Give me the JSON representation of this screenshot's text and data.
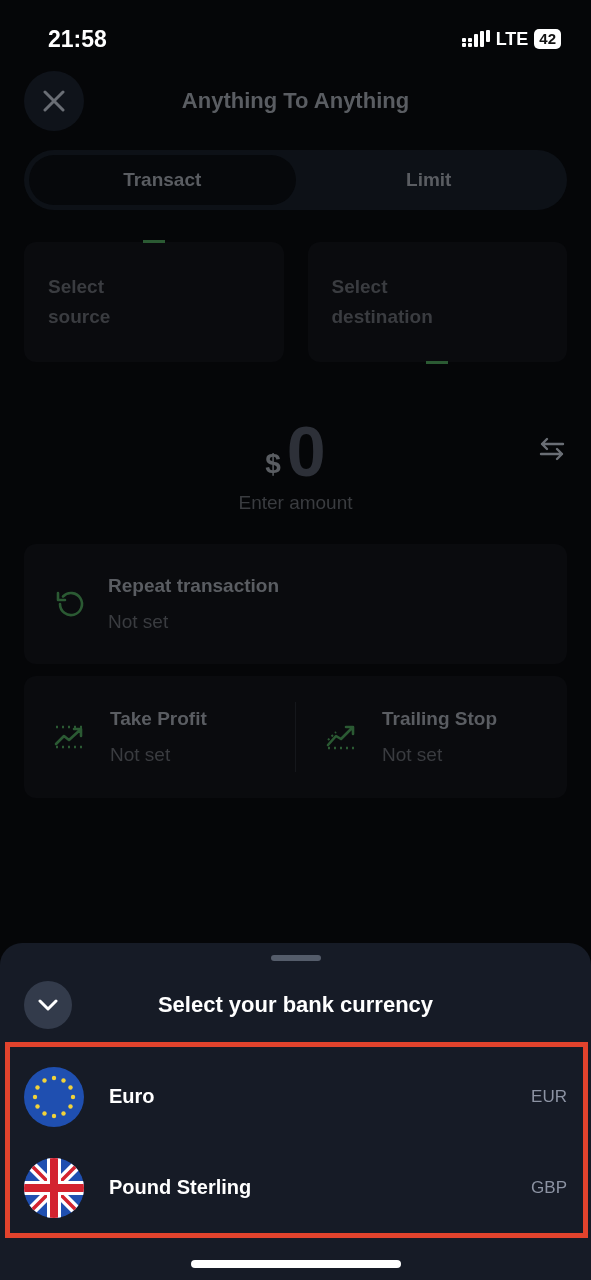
{
  "status_bar": {
    "time": "21:58",
    "network": "LTE",
    "battery": "42"
  },
  "header": {
    "title": "Anything To Anything"
  },
  "tabs": [
    {
      "label": "Transact",
      "selected": true
    },
    {
      "label": "Limit",
      "selected": false
    }
  ],
  "pickers": [
    {
      "kind": "source",
      "label": "Select\nsource"
    },
    {
      "kind": "destination",
      "label": "Select\ndestination"
    }
  ],
  "amount": {
    "currency": "$",
    "value": "0",
    "hint": "Enter amount"
  },
  "repeat": {
    "title": "Repeat transaction",
    "value": "Not set"
  },
  "orders": [
    {
      "kind": "profit",
      "title": "Take Profit",
      "value": "Not set"
    },
    {
      "kind": "trailing",
      "title": "Trailing Stop",
      "value": "Not set"
    }
  ],
  "sheet": {
    "title": "Select your bank currency",
    "currencies": [
      {
        "kind": "eu",
        "name": "Euro",
        "code": "EUR"
      },
      {
        "kind": "gb",
        "name": "Pound Sterling",
        "code": "GBP"
      }
    ]
  }
}
